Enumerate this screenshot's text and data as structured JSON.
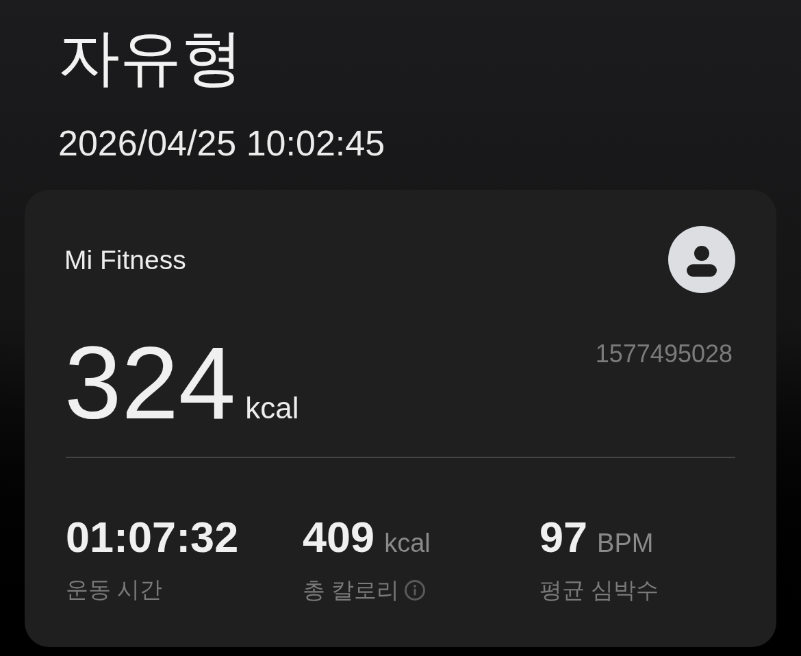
{
  "title": "자유형",
  "datetime": "2026/04/25 10:02:45",
  "card": {
    "source": "Mi Fitness",
    "device_id": "1577495028",
    "calories": {
      "value": "324",
      "unit": "kcal"
    },
    "stats": [
      {
        "value": "01:07:32",
        "label": "운동 시간",
        "info": false
      },
      {
        "value": "409",
        "unit": "kcal",
        "label": "총 칼로리",
        "info": true
      },
      {
        "value": "97",
        "unit": "BPM",
        "label": "평균 심박수",
        "info": false
      }
    ]
  }
}
